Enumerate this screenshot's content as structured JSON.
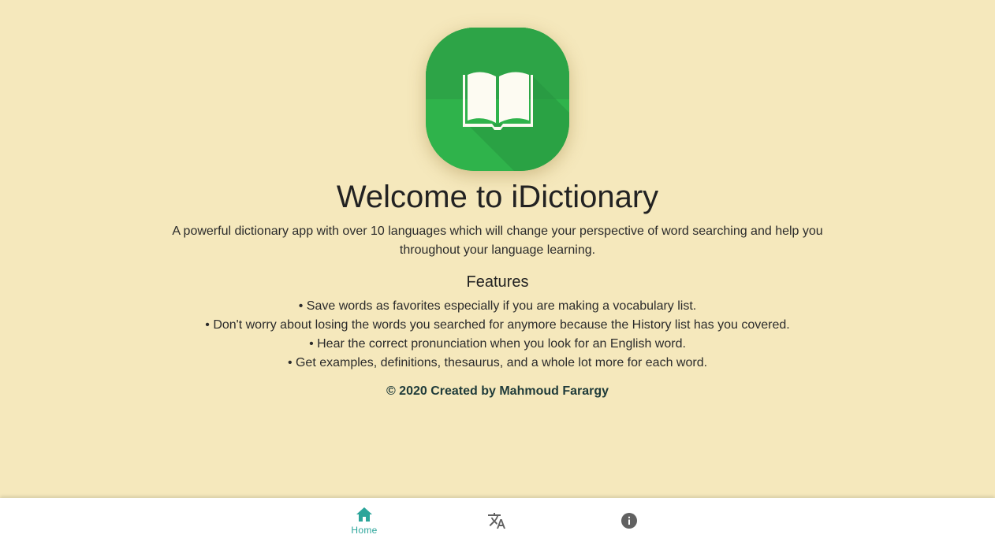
{
  "header": {
    "title": "Welcome to iDictionary",
    "description": "A powerful dictionary app with over 10 languages which will change your perspective of word searching and help you throughout your language learning."
  },
  "features": {
    "heading": "Features",
    "items": [
      "• Save words as favorites especially if you are making a vocabulary list.",
      "• Don't worry about losing the words you searched for anymore because the History list has you covered.",
      "• Hear the correct pronunciation when you look for an English word.",
      "• Get examples, definitions, thesaurus, and a whole lot more for each word."
    ]
  },
  "footer": {
    "credit": "© 2020 Created by Mahmoud Farargy"
  },
  "bottom_nav": {
    "items": [
      {
        "label": "Home",
        "icon": "home-icon",
        "active": true
      },
      {
        "label": "",
        "icon": "translate-icon",
        "active": false
      },
      {
        "label": "",
        "icon": "info-icon",
        "active": false
      }
    ]
  },
  "colors": {
    "background": "#f5e8bc",
    "logo_green": "#2fb34b",
    "active_nav": "#2ba59a",
    "inactive_nav": "#616161"
  }
}
